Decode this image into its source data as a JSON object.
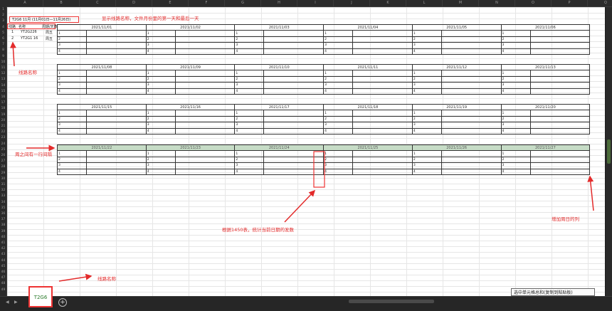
{
  "columns": [
    "A",
    "B",
    "C",
    "D",
    "E",
    "F",
    "G",
    "H",
    "I",
    "J",
    "K",
    "L",
    "M",
    "N",
    "O",
    "P",
    "Q"
  ],
  "rows": [
    "1",
    "2",
    "3",
    "4",
    "5",
    "6",
    "7",
    "8",
    "9",
    "10",
    "11",
    "12",
    "13",
    "14",
    "15",
    "16",
    "17",
    "18",
    "19",
    "20",
    "21",
    "22",
    "23",
    "24",
    "25",
    "26",
    "27",
    "28",
    "29",
    "30",
    "31",
    "32",
    "33",
    "34",
    "35",
    "36",
    "37",
    "38",
    "39",
    "40",
    "41",
    "42",
    "43",
    "44",
    "45",
    "46",
    "47",
    "48",
    "49"
  ],
  "title_cell": "T2G6 11月 (11月01日—11月26日)",
  "route_header": {
    "col1": "线路",
    "col2": "名称",
    "col3": "周期/天数"
  },
  "routes": [
    {
      "no": "1",
      "name": "YT2G226",
      "day": "周五"
    },
    {
      "no": "2",
      "name": "YT2G1 16",
      "day": "周五"
    }
  ],
  "block_rows": [
    "1",
    "2",
    "3",
    "4"
  ],
  "weeks": [
    [
      "2021/11/01",
      "2021/11/02",
      "2021/11/03",
      "2021/11/04",
      "2021/11/05",
      "2021/11/06"
    ],
    [
      "2021/11/08",
      "2021/11/09",
      "2021/11/10",
      "2021/11/11",
      "2021/11/12",
      "2021/11/13"
    ],
    [
      "2021/11/15",
      "2021/11/16",
      "2021/11/17",
      "2021/11/18",
      "2021/11/19",
      "2021/11/20"
    ],
    [
      "2021/11/22",
      "2021/11/23",
      "2021/11/24",
      "2021/11/25",
      "2021/11/26",
      "2021/11/27"
    ]
  ],
  "annotations": {
    "top": "显示线路名称，文件月份里的第一天和最后一天",
    "route_name": "线路名称",
    "gap": "周之间有一行间隔",
    "count": "根据1450表，统计当前日期的发数",
    "add_cols": "增加周日的列",
    "sheet_name": "线路名称"
  },
  "sheet_tab": "T2G6",
  "tooltip": "选中单元格总和(复制到粘贴板)",
  "colors": {
    "annotation": "#e32b2b",
    "highlight_row": "#c6dcc6"
  }
}
